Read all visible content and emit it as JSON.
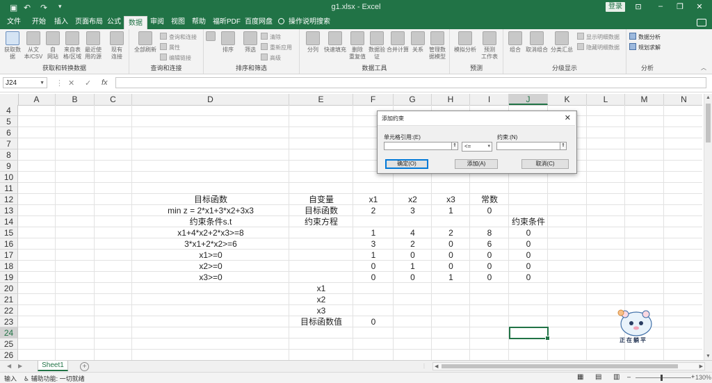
{
  "app": {
    "window_title": "g1.xlsx - Excel",
    "login_label": "登录"
  },
  "ribbon": {
    "tabs": [
      "文件",
      "开始",
      "插入",
      "页面布局",
      "公式",
      "数据",
      "审阅",
      "视图",
      "帮助",
      "福昕PDF",
      "百度网盘"
    ],
    "active_tab": "数据",
    "tell_me": "操作说明搜索",
    "groups": {
      "get_transform": {
        "label": "获取和转换数据",
        "buttons": [
          "获取数\n据",
          "从文\n本/CSV",
          "自\n网站",
          "来自表\n格/区域",
          "最近使\n用的源",
          "现有\n连接"
        ]
      },
      "queries": {
        "label": "查询和连接",
        "refresh": "全部刷新",
        "items": [
          "查询和连接",
          "属性",
          "编辑链接"
        ]
      },
      "sort_filter": {
        "label": "排序和筛选",
        "sort": "排序",
        "filter": "筛选",
        "items": [
          "清除",
          "重新应用",
          "高级"
        ]
      },
      "data_tools": {
        "label": "数据工具",
        "buttons": [
          "分列",
          "快速填充",
          "删除\n重复值",
          "数据验\n证",
          "合并计算",
          "关系",
          "管理数\n据模型"
        ]
      },
      "forecast": {
        "label": "预测",
        "buttons": [
          "模拟分析",
          "预测\n工作表"
        ]
      },
      "outline": {
        "label": "分级显示",
        "buttons": [
          "组合",
          "取消组合",
          "分类汇总"
        ],
        "items": [
          "显示明细数据",
          "隐藏明细数据"
        ]
      },
      "analysis": {
        "label": "分析",
        "items": [
          "数据分析",
          "规划求解"
        ]
      }
    }
  },
  "formula_bar": {
    "name_box": "J24",
    "cancel": "✕",
    "enter": "✓",
    "fx": "fx",
    "value": ""
  },
  "grid": {
    "columns": [
      "A",
      "B",
      "C",
      "D",
      "E",
      "F",
      "G",
      "H",
      "I",
      "J",
      "K",
      "L",
      "M",
      "N"
    ],
    "selected_column": "J",
    "rows": [
      4,
      5,
      6,
      7,
      8,
      9,
      10,
      11,
      12,
      13,
      14,
      15,
      16,
      17,
      18,
      19,
      20,
      21,
      22,
      23,
      24,
      25,
      26
    ],
    "selected_row": 24,
    "cells": {
      "D12": "目标函数",
      "D13": "min z = 2*x1+3*x2+3x3",
      "D14": "约束条件s.t",
      "D15": "x1+4*x2+2*x3>=8",
      "D16": "3*x1+2*x2>=6",
      "D17": "x1>=0",
      "D18": "x2>=0",
      "D19": "x3>=0",
      "E12": "自变量",
      "E13": "目标函数",
      "E14": "约束方程",
      "E20": "x1",
      "E21": "x2",
      "E22": "x3",
      "E23": "目标函数值",
      "F12": "x1",
      "G12": "x2",
      "H12": "x3",
      "I12": "常数",
      "F13": "2",
      "G13": "3",
      "H13": "1",
      "I13": "0",
      "J14": "约束条件",
      "F15": "1",
      "G15": "4",
      "H15": "2",
      "I15": "8",
      "J15": "0",
      "F16": "3",
      "G16": "2",
      "H16": "0",
      "I16": "6",
      "J16": "0",
      "F17": "1",
      "G17": "0",
      "H17": "0",
      "I17": "0",
      "J17": "0",
      "F18": "0",
      "G18": "1",
      "H18": "0",
      "I18": "0",
      "J18": "0",
      "F19": "0",
      "G19": "0",
      "H19": "1",
      "I19": "0",
      "J19": "0",
      "F23": "0"
    }
  },
  "sheets": {
    "tabs": [
      "Sheet1"
    ],
    "active": "Sheet1"
  },
  "status_bar": {
    "mode": "输入",
    "accessibility": "辅助功能: 一切就绪",
    "zoom": "130%"
  },
  "dialog": {
    "title": "添加约束",
    "cell_ref_label": "单元格引用:(E)",
    "operator": "<=",
    "constraint_label": "约束:(N)",
    "ok": "确定(O)",
    "add": "添加(A)",
    "cancel": "取消(C)"
  },
  "mascot": {
    "caption": "正在躺平"
  },
  "colors": {
    "excel_green": "#217346",
    "ribbon_bg": "#f3f3f3",
    "dialog_primary": "#0078d7"
  }
}
